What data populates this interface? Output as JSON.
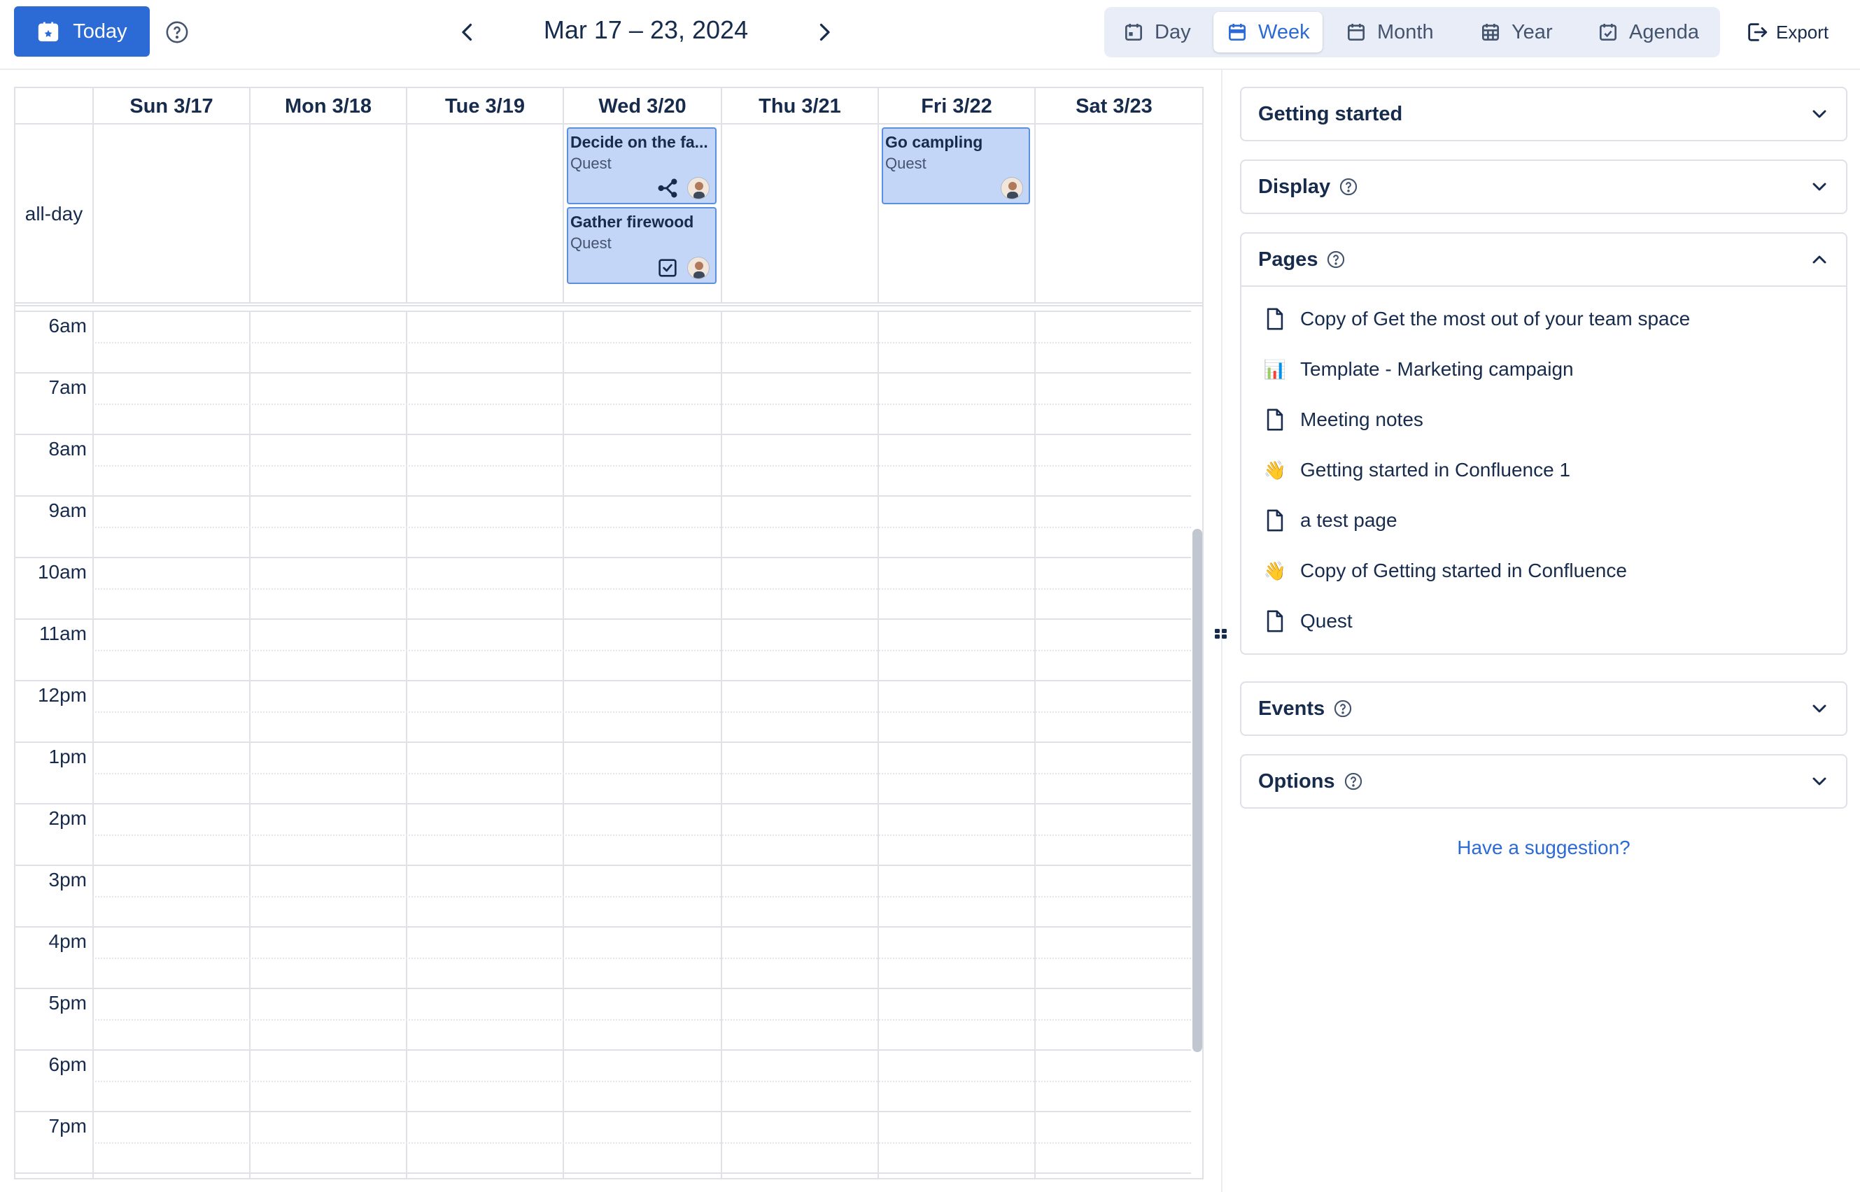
{
  "toolbar": {
    "today_label": "Today",
    "range_title": "Mar 17 – 23, 2024",
    "views": [
      "Day",
      "Week",
      "Month",
      "Year",
      "Agenda"
    ],
    "active_view": "Week",
    "export_label": "Export"
  },
  "calendar": {
    "days": [
      "Sun 3/17",
      "Mon 3/18",
      "Tue 3/19",
      "Wed 3/20",
      "Thu 3/21",
      "Fri 3/22",
      "Sat 3/23"
    ],
    "allday_label": "all-day",
    "hours": [
      "6am",
      "7am",
      "8am",
      "9am",
      "10am",
      "11am",
      "12pm",
      "1pm",
      "2pm",
      "3pm",
      "4pm",
      "5pm",
      "6pm",
      "7pm"
    ],
    "events": [
      {
        "title": "Decide on the fa...",
        "subtitle": "Quest",
        "day": "Wed 3/20",
        "icon": "branch-icon"
      },
      {
        "title": "Gather firewood",
        "subtitle": "Quest",
        "day": "Wed 3/20",
        "icon": "checkbox-icon"
      },
      {
        "title": "Go campling",
        "subtitle": "Quest",
        "day": "Fri 3/22",
        "icon": ""
      }
    ]
  },
  "sidebar": {
    "panels": [
      {
        "title": "Getting started",
        "help": false,
        "expanded": false
      },
      {
        "title": "Display",
        "help": true,
        "expanded": false
      },
      {
        "title": "Pages",
        "help": true,
        "expanded": true
      },
      {
        "title": "Events",
        "help": true,
        "expanded": false
      },
      {
        "title": "Options",
        "help": true,
        "expanded": false
      }
    ],
    "pages": [
      {
        "label": "Copy of Get the most out of your team space",
        "icon": "page-icon"
      },
      {
        "label": "Template - Marketing campaign",
        "icon": "📊"
      },
      {
        "label": "Meeting notes",
        "icon": "page-icon"
      },
      {
        "label": "Getting started in Confluence 1",
        "icon": "👋"
      },
      {
        "label": "a test page",
        "icon": "page-icon"
      },
      {
        "label": "Copy of Getting started in Confluence",
        "icon": "👋"
      },
      {
        "label": "Quest",
        "icon": "page-icon"
      }
    ],
    "suggestion_link": "Have a suggestion?"
  },
  "colors": {
    "accent": "#2c6ad6",
    "event_bg": "#c4d6f7",
    "event_border": "#5b8fe0",
    "grid_line": "#dfe1e6"
  }
}
